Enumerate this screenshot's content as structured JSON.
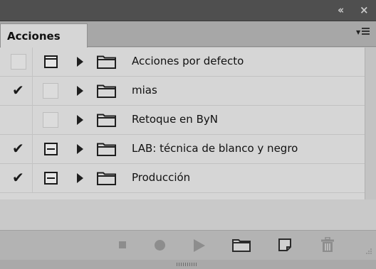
{
  "titlebar": {
    "collapse_icon": "double-chevron-left-icon",
    "close_icon": "close-icon"
  },
  "panel": {
    "tab_label": "Acciones",
    "menu_icon": "panel-menu-icon"
  },
  "rows": [
    {
      "name": "Acciones por defecto",
      "check": "",
      "check_state": "empty",
      "dialog": "full"
    },
    {
      "name": "mias",
      "check": "✔",
      "check_state": "on",
      "dialog": "empty"
    },
    {
      "name": "Retoque en ByN",
      "check": "",
      "check_state": "none",
      "dialog": "empty"
    },
    {
      "name": "LAB: técnica de blanco y negro",
      "check": "✔",
      "check_state": "on",
      "dialog": "dash"
    },
    {
      "name": "Producción",
      "check": "✔",
      "check_state": "on",
      "dialog": "dash"
    }
  ],
  "bottombar": {
    "buttons": [
      "stop-icon",
      "record-icon",
      "play-icon",
      "new-set-icon",
      "new-action-icon",
      "trash-icon"
    ]
  },
  "colors": {
    "panel_bg": "#d6d6d6",
    "titlebar": "#4f4f4f",
    "icon_gray": "#8d8d8d"
  }
}
